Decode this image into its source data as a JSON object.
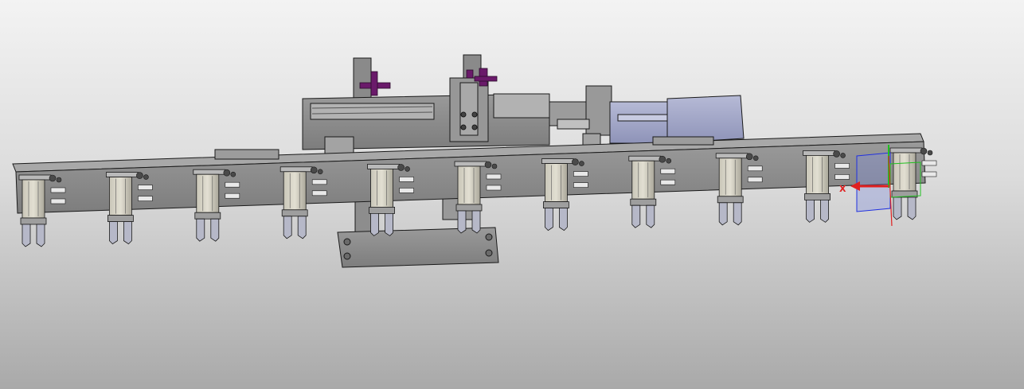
{
  "viewport": {
    "background_top": "#f3f3f3",
    "background_bottom": "#a9a9a9"
  },
  "model": {
    "part_color": "#8f8f8f",
    "edge_color": "#1a1a1a",
    "motor_color": "#a0a6c8",
    "handle_color": "#6a1a6a",
    "gripper_count": 11
  },
  "triad": {
    "x_label": "X",
    "x_color": "#e02020",
    "y_color": "#20c020",
    "z_color": "#2030e0",
    "plane_color": "#8090e0"
  }
}
